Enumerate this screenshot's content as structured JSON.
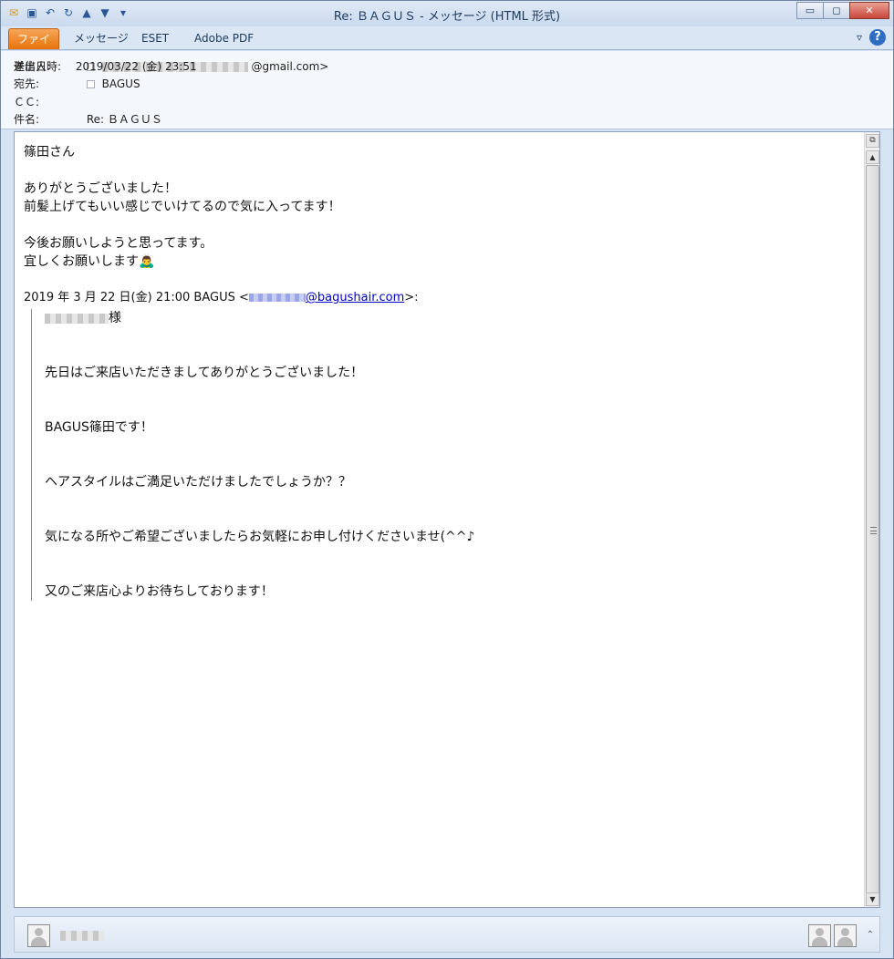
{
  "window": {
    "title": "Re: ＢＡＧＵＳ - メッセージ (HTML 形式)",
    "min_label": "▭",
    "max_label": "◻",
    "close_label": "✕"
  },
  "ribbon": {
    "tabs": [
      {
        "label": "ファイル"
      },
      {
        "label": "メッセージ"
      },
      {
        "label": "ESET"
      },
      {
        "label": "Adobe PDF"
      }
    ],
    "help_label": "?",
    "expand_label": "▿"
  },
  "header": {
    "from_label": "差出人:",
    "from_value": "@gmail.com>",
    "to_label": "宛先:",
    "to_value": "BAGUS",
    "cc_label": "ＣＣ:",
    "subject_label": "件名:",
    "subject_value": "Re: ＢＡＧＵＳ",
    "sent_label": "送信日時:",
    "sent_value": "2019/03/22 (金) 23:51"
  },
  "body": {
    "greeting": "篠田さん",
    "line1": "ありがとうございました！",
    "line2": "前髪上げてもいい感じでいけてるので気に入ってます！",
    "line3": "今後お願いしようと思ってます。",
    "line4": "宜しくお願いします🙇‍♂️",
    "quote_header_prefix": "2019 年 3 月 22 日(金) 21:00 BAGUS <",
    "quote_header_link": "@bagushair.com",
    "quote_header_suffix": ">:",
    "quote_salutation": "様",
    "quote_lines": [
      "先日はご来店いただきましてありがとうございました！",
      "BAGUS篠田です！",
      "ヘアスタイルはご満足いただけましたでしょうか？？",
      "気になる所やご希望ございましたらお気軽にお申し付けくださいませ(^^♪",
      "又のご来店心よりお待ちしております！"
    ]
  },
  "footer": {
    "collapse_label": "⌃"
  }
}
